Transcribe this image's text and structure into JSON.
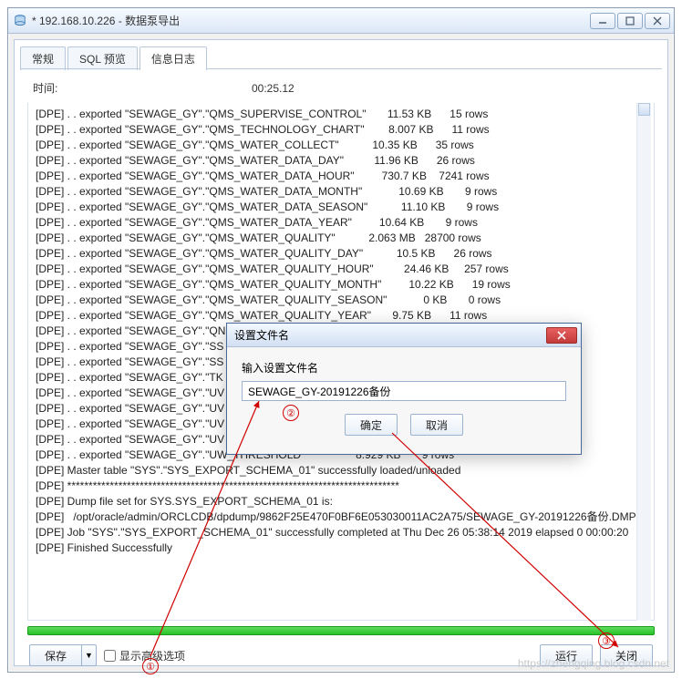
{
  "window": {
    "title": "* 192.168.10.226 - 数据泵导出"
  },
  "tabs": {
    "t0": "常规",
    "t1": "SQL 预览",
    "t2": "信息日志"
  },
  "time": {
    "label": "时间:",
    "value": "00:25.12"
  },
  "log_lines": [
    "[DPE] . . exported \"SEWAGE_GY\".\"QMS_SUPERVISE_CONTROL\"       11.53 KB      15 rows",
    "[DPE] . . exported \"SEWAGE_GY\".\"QMS_TECHNOLOGY_CHART\"        8.007 KB      11 rows",
    "[DPE] . . exported \"SEWAGE_GY\".\"QMS_WATER_COLLECT\"           10.35 KB      35 rows",
    "[DPE] . . exported \"SEWAGE_GY\".\"QMS_WATER_DATA_DAY\"          11.96 KB      26 rows",
    "[DPE] . . exported \"SEWAGE_GY\".\"QMS_WATER_DATA_HOUR\"         730.7 KB    7241 rows",
    "[DPE] . . exported \"SEWAGE_GY\".\"QMS_WATER_DATA_MONTH\"            10.69 KB       9 rows",
    "[DPE] . . exported \"SEWAGE_GY\".\"QMS_WATER_DATA_SEASON\"           11.10 KB       9 rows",
    "[DPE] . . exported \"SEWAGE_GY\".\"QMS_WATER_DATA_YEAR\"         10.64 KB       9 rows",
    "[DPE] . . exported \"SEWAGE_GY\".\"QMS_WATER_QUALITY\"           2.063 MB   28700 rows",
    "[DPE] . . exported \"SEWAGE_GY\".\"QMS_WATER_QUALITY_DAY\"           10.5 KB      26 rows",
    "[DPE] . . exported \"SEWAGE_GY\".\"QMS_WATER_QUALITY_HOUR\"          24.46 KB     257 rows",
    "[DPE] . . exported \"SEWAGE_GY\".\"QMS_WATER_QUALITY_MONTH\"         10.22 KB      19 rows",
    "[DPE] . . exported \"SEWAGE_GY\".\"QMS_WATER_QUALITY_SEASON\"            0 KB       0 rows",
    "[DPE] . . exported \"SEWAGE_GY\".\"QMS_WATER_QUALITY_YEAR\"       9.75 KB      11 rows",
    "[DPE] . . exported \"SEWAGE_GY\".\"QN",
    "[DPE] . . exported \"SEWAGE_GY\".\"SS",
    "[DPE] . . exported \"SEWAGE_GY\".\"SS",
    "[DPE] . . exported \"SEWAGE_GY\".\"TK",
    "[DPE] . . exported \"SEWAGE_GY\".\"UV",
    "[DPE] . . exported \"SEWAGE_GY\".\"UV",
    "[DPE] . . exported \"SEWAGE_GY\".\"UV",
    "[DPE] . . exported \"SEWAGE_GY\".\"UV",
    "[DPE] . . exported \"SEWAGE_GY\".\"UW_THRESHOLD                  8.929 KB       9 rows",
    "[DPE] Master table \"SYS\".\"SYS_EXPORT_SCHEMA_01\" successfully loaded/unloaded",
    "[DPE] ******************************************************************************",
    "[DPE] Dump file set for SYS.SYS_EXPORT_SCHEMA_01 is:",
    "[DPE]   /opt/oracle/admin/ORCLCDB/dpdump/9862F25E470F0BF6E053030011AC2A75/SEWAGE_GY-20191226备份.DMP",
    "[DPE] Job \"SYS\".\"SYS_EXPORT_SCHEMA_01\" successfully completed at Thu Dec 26 05:38:14 2019 elapsed 0 00:00:20",
    "[DPE] Finished Successfully"
  ],
  "dialog": {
    "title": "设置文件名",
    "label": "输入设置文件名",
    "value": "SEWAGE_GY-20191226备份",
    "ok": "确定",
    "cancel": "取消"
  },
  "bottom": {
    "save": "保存",
    "advanced": "显示高级选项",
    "run": "运行",
    "close": "关闭"
  },
  "annotations": {
    "n1": "①",
    "n2": "②",
    "n3": "③"
  },
  "watermark": "https://zhengqing.blog.csdn.net"
}
